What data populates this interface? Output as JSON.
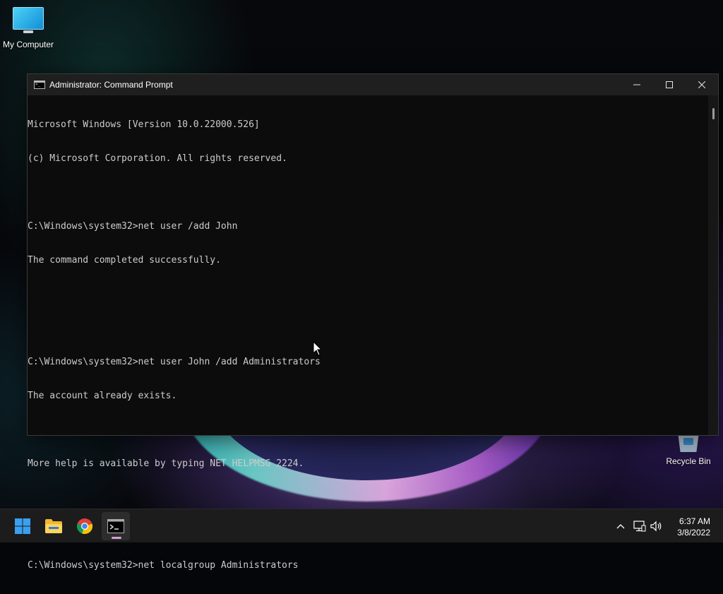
{
  "desktop": {
    "icons": [
      {
        "label": "My Computer",
        "icon": "monitor-icon"
      },
      {
        "label": "Recycle Bin",
        "icon": "recycle-bin-icon"
      }
    ]
  },
  "window": {
    "title": "Administrator: Command Prompt",
    "controls": [
      "minimize-icon",
      "maximize-icon",
      "close-icon"
    ],
    "console_lines": [
      "Microsoft Windows [Version 10.0.22000.526]",
      "(c) Microsoft Corporation. All rights reserved.",
      "",
      "C:\\Windows\\system32>net user /add John",
      "The command completed successfully.",
      "",
      "",
      "C:\\Windows\\system32>net user John /add Administrators",
      "The account already exists.",
      "",
      "More help is available by typing NET HELPMSG 2224.",
      "",
      "",
      "C:\\Windows\\system32>net localgroup Administrators"
    ]
  },
  "taskbar": {
    "apps": [
      {
        "name": "start-button",
        "icon": "windows-logo-icon"
      },
      {
        "name": "file-explorer",
        "icon": "folder-icon"
      },
      {
        "name": "chrome",
        "icon": "chrome-icon"
      },
      {
        "name": "command-prompt",
        "icon": "terminal-icon",
        "active": true
      }
    ],
    "tray": [
      "chevron-up-icon",
      "network-icon",
      "volume-icon"
    ],
    "clock": {
      "time": "6:37 AM",
      "date": "3/8/2022"
    }
  },
  "colors": {
    "console_bg": "#0c0c0c",
    "console_text": "#cccccc",
    "titlebar_bg": "#1f1f1f",
    "taskbar_bg": "#1c1c1c"
  }
}
